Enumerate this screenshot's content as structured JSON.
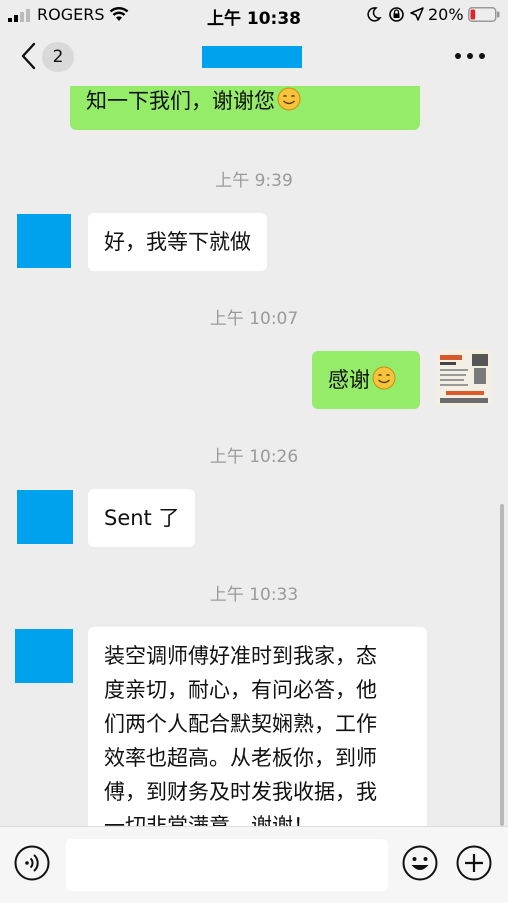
{
  "status_bar": {
    "carrier": "ROGERS",
    "time": "上午 10:38",
    "battery_percent": "20%",
    "battery_level": 0.2
  },
  "nav": {
    "unread_count": "2"
  },
  "messages": [
    {
      "direction": "out",
      "text": "知一下我们，谢谢您",
      "emoji": "smile"
    },
    {
      "type": "time",
      "text": "上午 9:39"
    },
    {
      "direction": "in",
      "text": "好，我等下就做"
    },
    {
      "type": "time",
      "text": "上午 10:07"
    },
    {
      "direction": "out",
      "text": "感谢",
      "emoji": "smile"
    },
    {
      "type": "time",
      "text": "上午 10:26"
    },
    {
      "direction": "in",
      "text": "Sent 了"
    },
    {
      "type": "time",
      "text": "上午 10:33"
    },
    {
      "direction": "in",
      "lines": [
        "装空调师傅好准时到我家，态",
        "度亲切，耐心，有问必答，他",
        "们两个人配合默契娴熟，工作",
        "效率也超高。从老板你，到师",
        "傅，到财务及时发我收据，我",
        "一切非常满意，谢谢！"
      ]
    }
  ],
  "colors": {
    "outgoing_bubble": "#95ec69",
    "incoming_bubble": "#ffffff",
    "redacted_block": "#00a2ed",
    "background": "#ededed"
  },
  "icons": [
    "signal-icon",
    "wifi-icon",
    "moon-icon",
    "rotation-lock-icon",
    "location-arrow-icon",
    "battery-icon",
    "back-chevron-icon",
    "more-icon",
    "voice-icon",
    "emoji-icon",
    "plus-icon"
  ]
}
